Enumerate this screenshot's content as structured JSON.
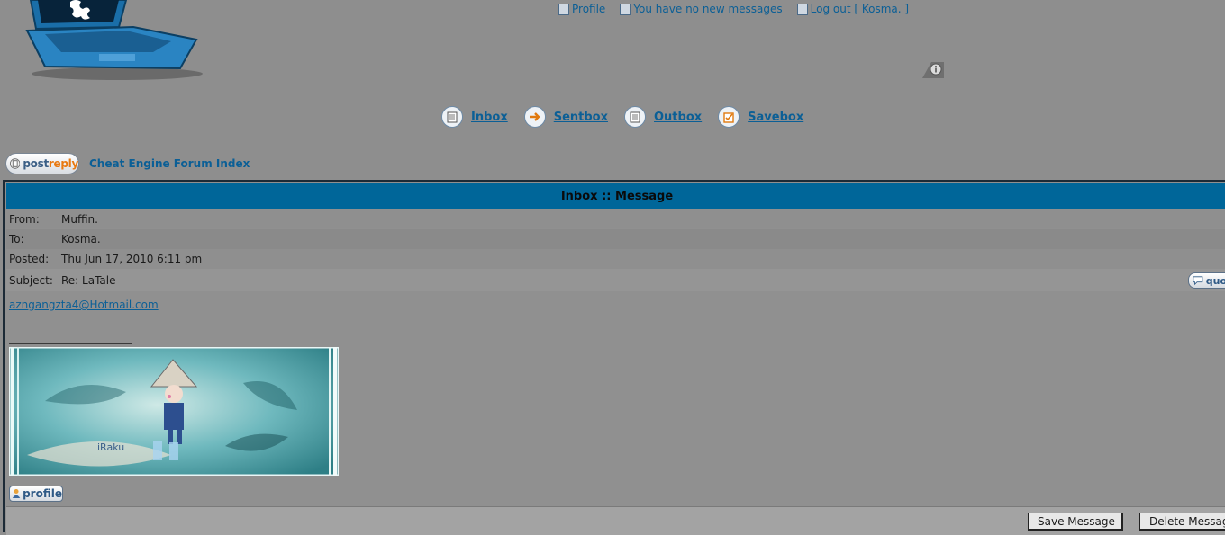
{
  "header": {
    "links": {
      "profile": "Profile",
      "messages": "You have no new messages",
      "logout": "Log out [ Kosma. ]"
    }
  },
  "mailboxes": [
    {
      "label": "Inbox",
      "icon": "inbox-icon"
    },
    {
      "label": "Sentbox",
      "icon": "sentbox-arrow-icon"
    },
    {
      "label": "Outbox",
      "icon": "outbox-icon"
    },
    {
      "label": "Savebox",
      "icon": "savebox-check-icon"
    }
  ],
  "nav": {
    "post_reply_a": "post",
    "post_reply_b": "reply",
    "forum_index": "Cheat Engine Forum Index"
  },
  "message": {
    "header": "Inbox :: Message",
    "from_label": "From:",
    "from": "Muffin.",
    "to_label": "To:",
    "to": "Kosma.",
    "posted_label": "Posted:",
    "posted": "Thu Jun 17, 2010 6:11 pm",
    "subject_label": "Subject:",
    "subject": "Re: LaTale",
    "quote_label": "quo",
    "body_email": "azngangzta4@Hotmail.com",
    "signature_text": "iRaku",
    "profile_label": "profile"
  },
  "actions": {
    "save": "Save Message",
    "delete": "Delete Messag"
  },
  "colors": {
    "page_bg": "#8e8e8e",
    "header_bar": "#006699",
    "link": "#0b5f96"
  }
}
